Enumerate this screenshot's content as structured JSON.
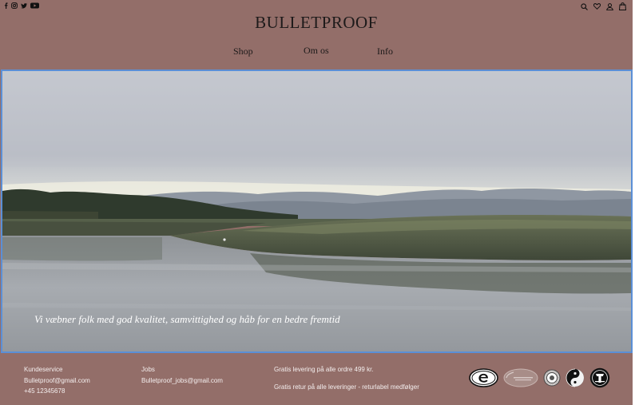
{
  "header": {
    "brand": "BULLETPROOF",
    "social_icons": [
      "facebook-icon",
      "instagram-icon",
      "twitter-icon",
      "youtube-icon"
    ],
    "tool_icons": [
      "search-icon",
      "heart-icon",
      "user-icon",
      "bag-icon"
    ]
  },
  "nav": {
    "items": [
      {
        "label": "Shop"
      },
      {
        "label": "Om os"
      },
      {
        "label": "Info"
      }
    ]
  },
  "hero": {
    "tagline": "Vi væbner folk med god kvalitet, samvittighed og håb for en bedre fremtid"
  },
  "footer": {
    "customer_service": {
      "title": "Kundeservice",
      "email": "Bulletproof@gmail.com",
      "phone": "+45 12345678"
    },
    "jobs": {
      "title": "Jobs",
      "email": "Bulletproof_jobs@gmail.com"
    },
    "shipping": {
      "free_delivery": "Gratis levering på alle ordre  499 kr.",
      "free_return": "Gratis retur på alle leveringer - returlabel medfølger"
    },
    "badges": [
      "e-label-icon",
      "global-recycled-standard-icon",
      "certification-seal-icon",
      "yin-yang-icon",
      "fairtrade-icon"
    ]
  },
  "colors": {
    "background": "#936e69",
    "text": "#1d1a1a",
    "hero_border": "#5b8fd6"
  }
}
